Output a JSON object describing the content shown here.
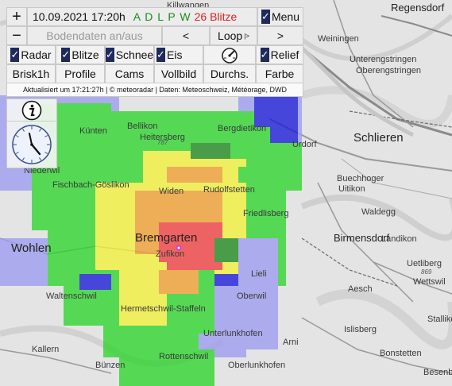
{
  "toolbar": {
    "zoom_in": "+",
    "zoom_out": "−",
    "datetime": "10.09.2021 17:20h",
    "lightning_letters": [
      "A",
      "D",
      "L",
      "P",
      "W"
    ],
    "lightning_count": "26 Blitze",
    "menu_label": "Menu",
    "ground_data": "Bodendaten an/aus",
    "prev": "<",
    "loop": "Loop",
    "loop_mark": "|>",
    "next": ">",
    "layers": [
      {
        "label": "Radar",
        "checked": true
      },
      {
        "label": "Blitze",
        "checked": true
      },
      {
        "label": "Schnee",
        "checked": true
      },
      {
        "label": "Eis",
        "checked": true
      },
      {
        "label": "Relief",
        "checked": true
      }
    ],
    "actions": [
      "Brisk1h",
      "Profile",
      "Cams",
      "Vollbild",
      "Durchs.",
      "Farbe"
    ],
    "status_text": "Aktualisiert um 17:21:27h | © meteoradar | Daten: Meteoschweiz, Météorage, DWD",
    "check_mark": "✓"
  },
  "map": {
    "places": [
      {
        "name": "Regensdorf",
        "size": "lg"
      },
      {
        "name": "Killwangen",
        "size": "sm"
      },
      {
        "name": "Weiningen",
        "size": "sm"
      },
      {
        "name": "Unterengstringen",
        "size": "sm"
      },
      {
        "name": "Oberengstringen",
        "size": "sm"
      },
      {
        "name": "Schlieren",
        "size": "xl"
      },
      {
        "name": "Künten",
        "size": "sm"
      },
      {
        "name": "Bellikon",
        "size": "sm"
      },
      {
        "name": "Heitersberg",
        "size": "sm"
      },
      {
        "name": "Bergdietikon",
        "size": "sm"
      },
      {
        "name": "Urdorf",
        "size": "sm"
      },
      {
        "name": "Uitikon",
        "size": "sm"
      },
      {
        "name": "Buechhoger",
        "size": "sm"
      },
      {
        "name": "Niederwil",
        "size": "sm"
      },
      {
        "name": "Fischbach-Göslikon",
        "size": "sm"
      },
      {
        "name": "Widen",
        "size": "sm"
      },
      {
        "name": "Rudolfstetten",
        "size": "sm"
      },
      {
        "name": "Friedlisberg",
        "size": "sm"
      },
      {
        "name": "Waldegg",
        "size": "sm"
      },
      {
        "name": "Birmensdorf",
        "size": "lg"
      },
      {
        "name": "Landikon",
        "size": "sm"
      },
      {
        "name": "Bremgarten",
        "size": "xl"
      },
      {
        "name": "Zufikon",
        "size": "sm"
      },
      {
        "name": "Wohlen",
        "size": "xl"
      },
      {
        "name": "Uetliberg",
        "size": "sm"
      },
      {
        "name": "Lieli",
        "size": "sm"
      },
      {
        "name": "Wettswil",
        "size": "sm"
      },
      {
        "name": "Waltenschwil",
        "size": "sm"
      },
      {
        "name": "Oberwil",
        "size": "sm"
      },
      {
        "name": "Aesch",
        "size": "sm"
      },
      {
        "name": "Hermetschwil-Staffeln",
        "size": "sm"
      },
      {
        "name": "Unterlunkhofen",
        "size": "sm"
      },
      {
        "name": "Stallikon",
        "size": "sm"
      },
      {
        "name": "Arni",
        "size": "sm"
      },
      {
        "name": "Islisberg",
        "size": "sm"
      },
      {
        "name": "Kallern",
        "size": "sm"
      },
      {
        "name": "Bonstetten",
        "size": "sm"
      },
      {
        "name": "Bünzen",
        "size": "sm"
      },
      {
        "name": "Rottenschwil",
        "size": "sm"
      },
      {
        "name": "Oberlunkhofen",
        "size": "sm"
      },
      {
        "name": "Besenbüren",
        "size": "sm"
      }
    ],
    "altitudes": [
      "787",
      "869"
    ]
  },
  "colors": {
    "light_blue": "#9c9cf0",
    "blue": "#1a1ad9",
    "green": "#2dd62d",
    "dark_green": "#1e8a1e",
    "yellow": "#f2f23a",
    "orange": "#f0a030",
    "red": "#f04040",
    "check_bg": "#1e2a5c",
    "lightning_letters": "#1a8a1a",
    "lightning_count": "#e02020"
  },
  "icons": {
    "info": "info-icon",
    "clock": "clock-icon",
    "gauge": "gauge-icon"
  }
}
